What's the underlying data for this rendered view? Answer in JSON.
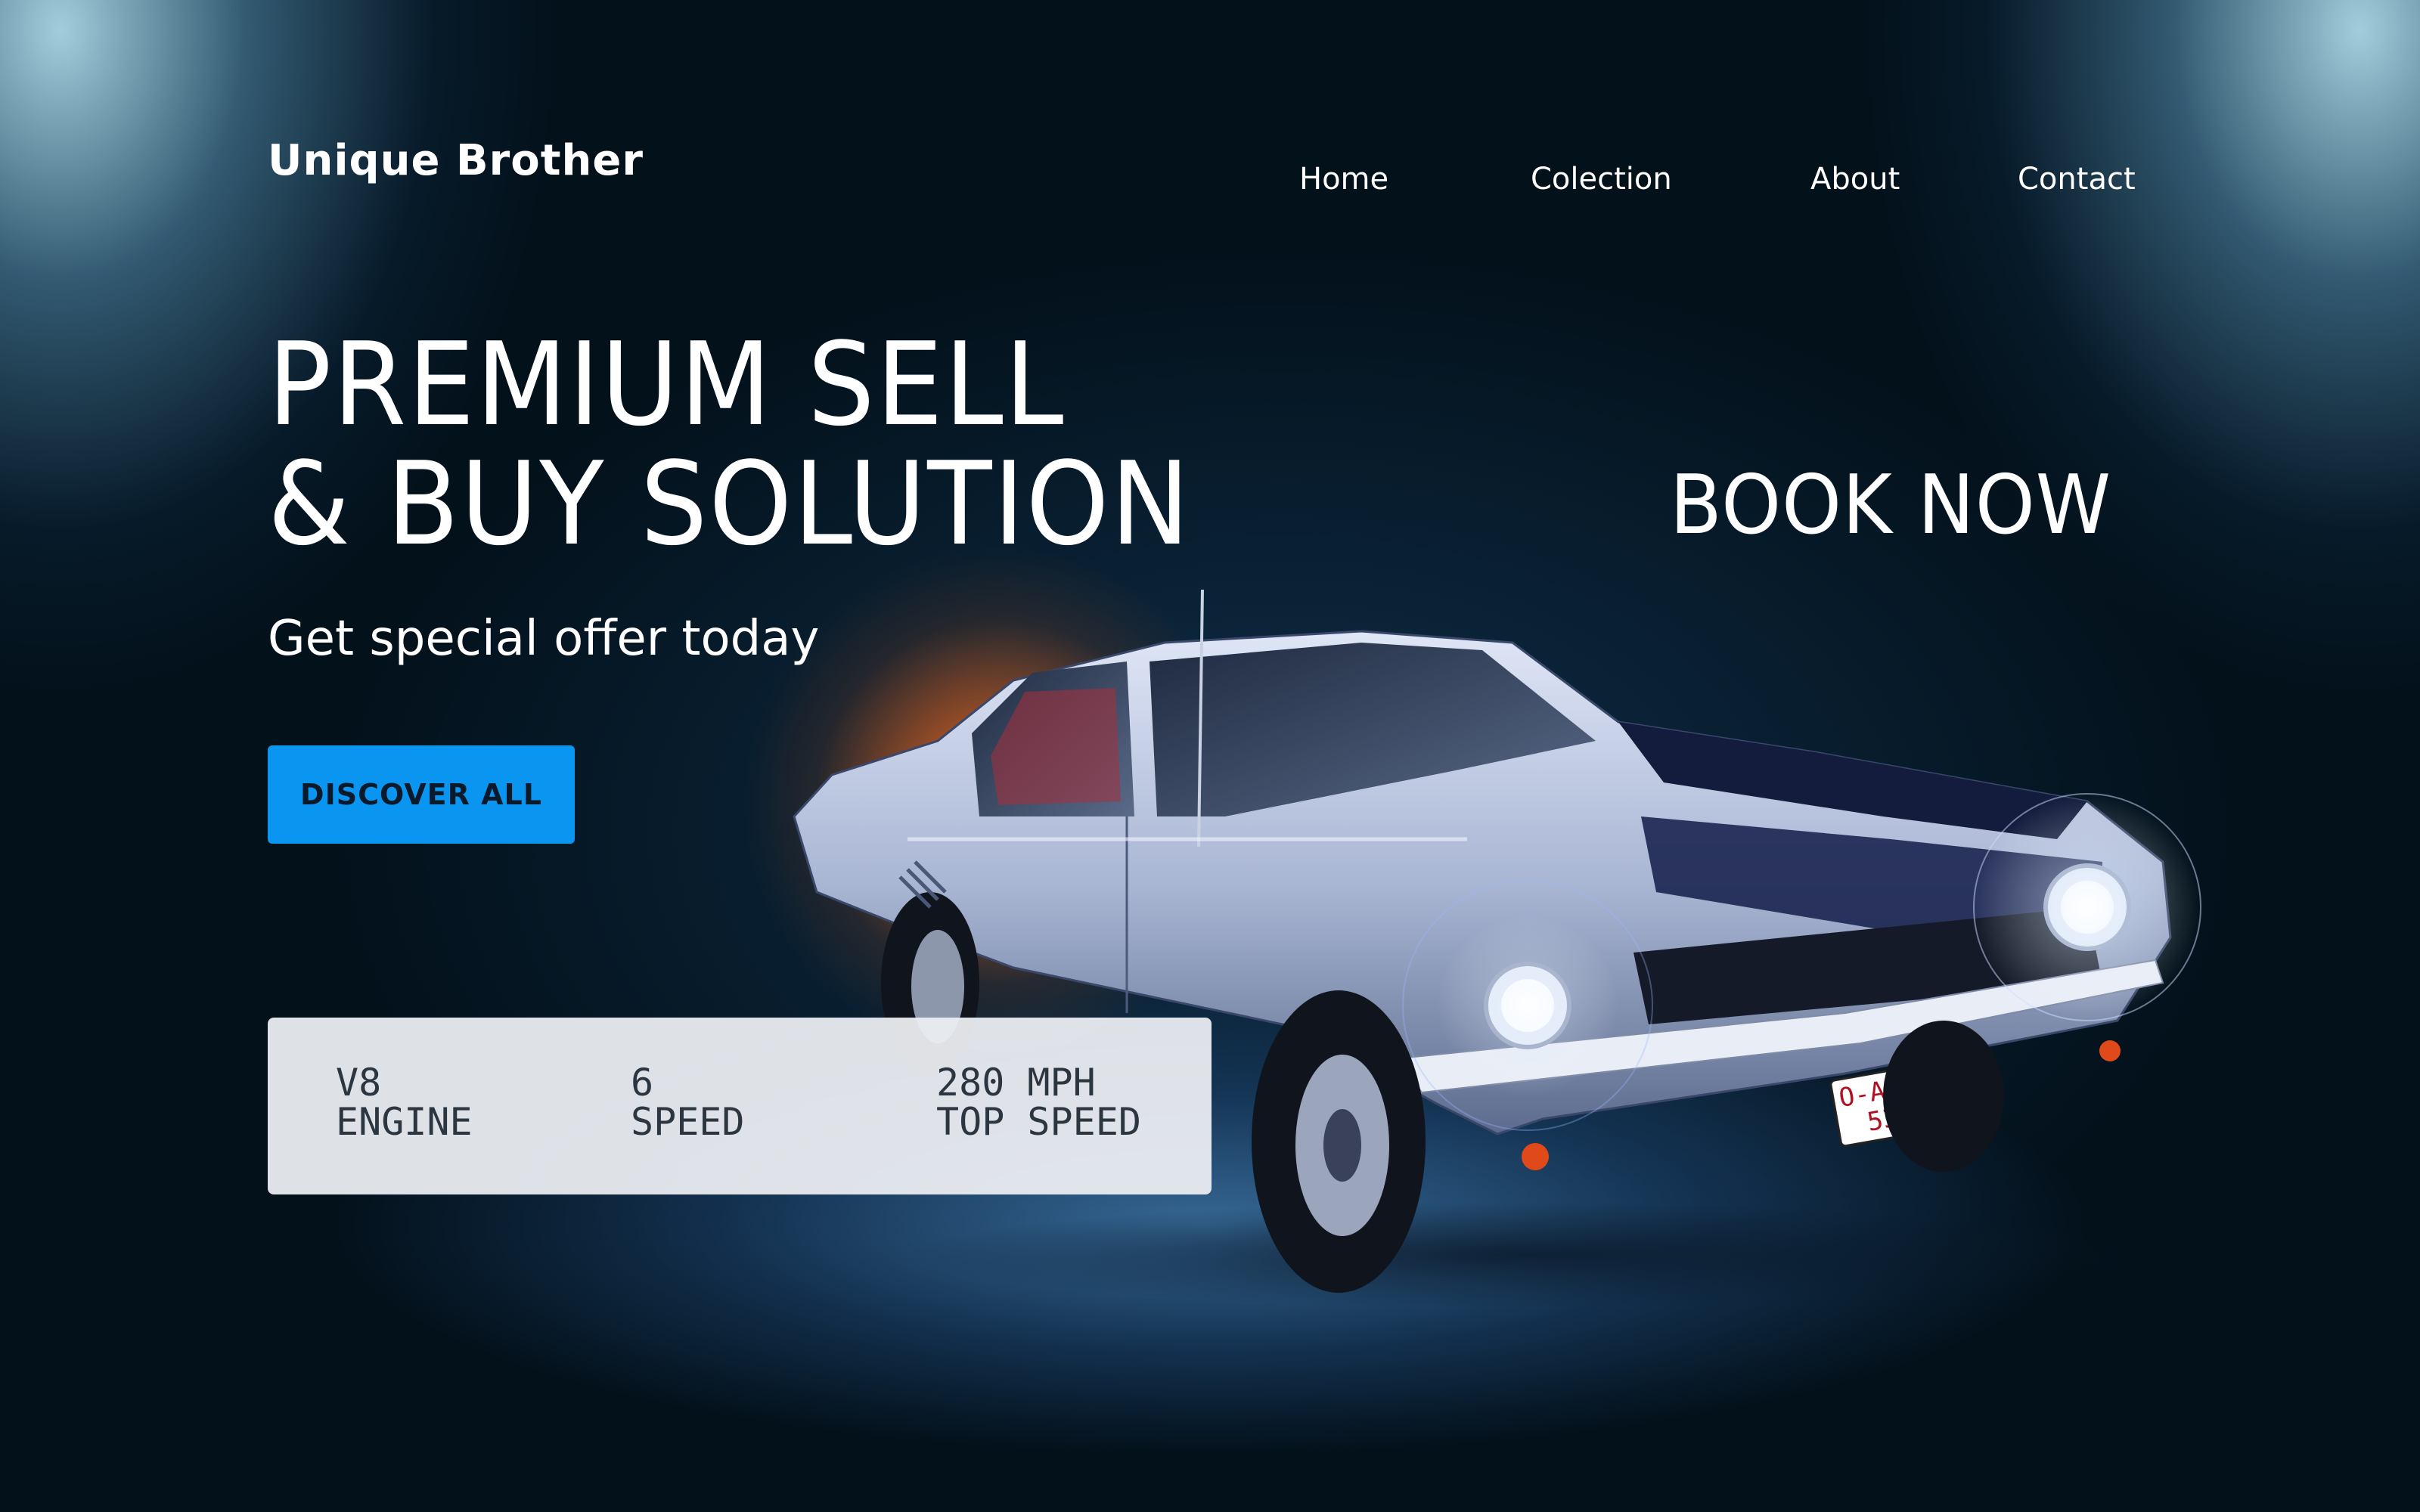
{
  "brand": {
    "name": "Unique Brother"
  },
  "nav": {
    "items": [
      {
        "label": "Home"
      },
      {
        "label": "Colection"
      },
      {
        "label": "About"
      },
      {
        "label": "Contact"
      }
    ]
  },
  "hero": {
    "headline_line1": "PREMIUM SELL",
    "headline_line2": "& BUY SOLUTION",
    "subtitle": "Get special offer today",
    "cta_label": "DISCOVER ALL",
    "book_now": "BOOK NOW"
  },
  "specs": [
    {
      "value": "V8",
      "label": "ENGINE"
    },
    {
      "value": "6",
      "label": "SPEED"
    },
    {
      "value": "280 MPH",
      "label": "TOP SPEED"
    }
  ],
  "car": {
    "plate_line1": "O-AZB",
    "plate_line2": "530"
  },
  "colors": {
    "accent": "#0a96f0",
    "background": "#03111b",
    "glow": "#f5782a"
  }
}
